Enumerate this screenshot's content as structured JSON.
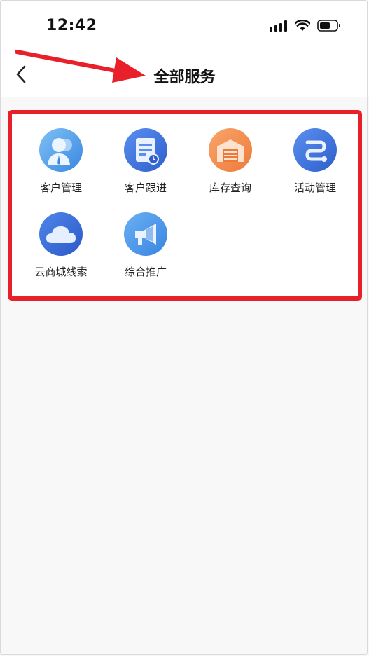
{
  "status_bar": {
    "time": "12:42"
  },
  "header": {
    "title": "全部服务"
  },
  "services": [
    {
      "label": "客户管理",
      "icon": "customer-icon",
      "color": "#4a9be8"
    },
    {
      "label": "客户跟进",
      "icon": "follow-up-icon",
      "color": "#3b6fd6"
    },
    {
      "label": "库存查询",
      "icon": "warehouse-icon",
      "color": "#f28a4a"
    },
    {
      "label": "活动管理",
      "icon": "activity-icon",
      "color": "#3b6fd6"
    },
    {
      "label": "云商城线索",
      "icon": "cloud-icon",
      "color": "#3b6fd6"
    },
    {
      "label": "综合推广",
      "icon": "megaphone-icon",
      "color": "#3f8fe3"
    }
  ],
  "colors": {
    "highlight_border": "#e8202a",
    "background": "#f8f8f9"
  }
}
